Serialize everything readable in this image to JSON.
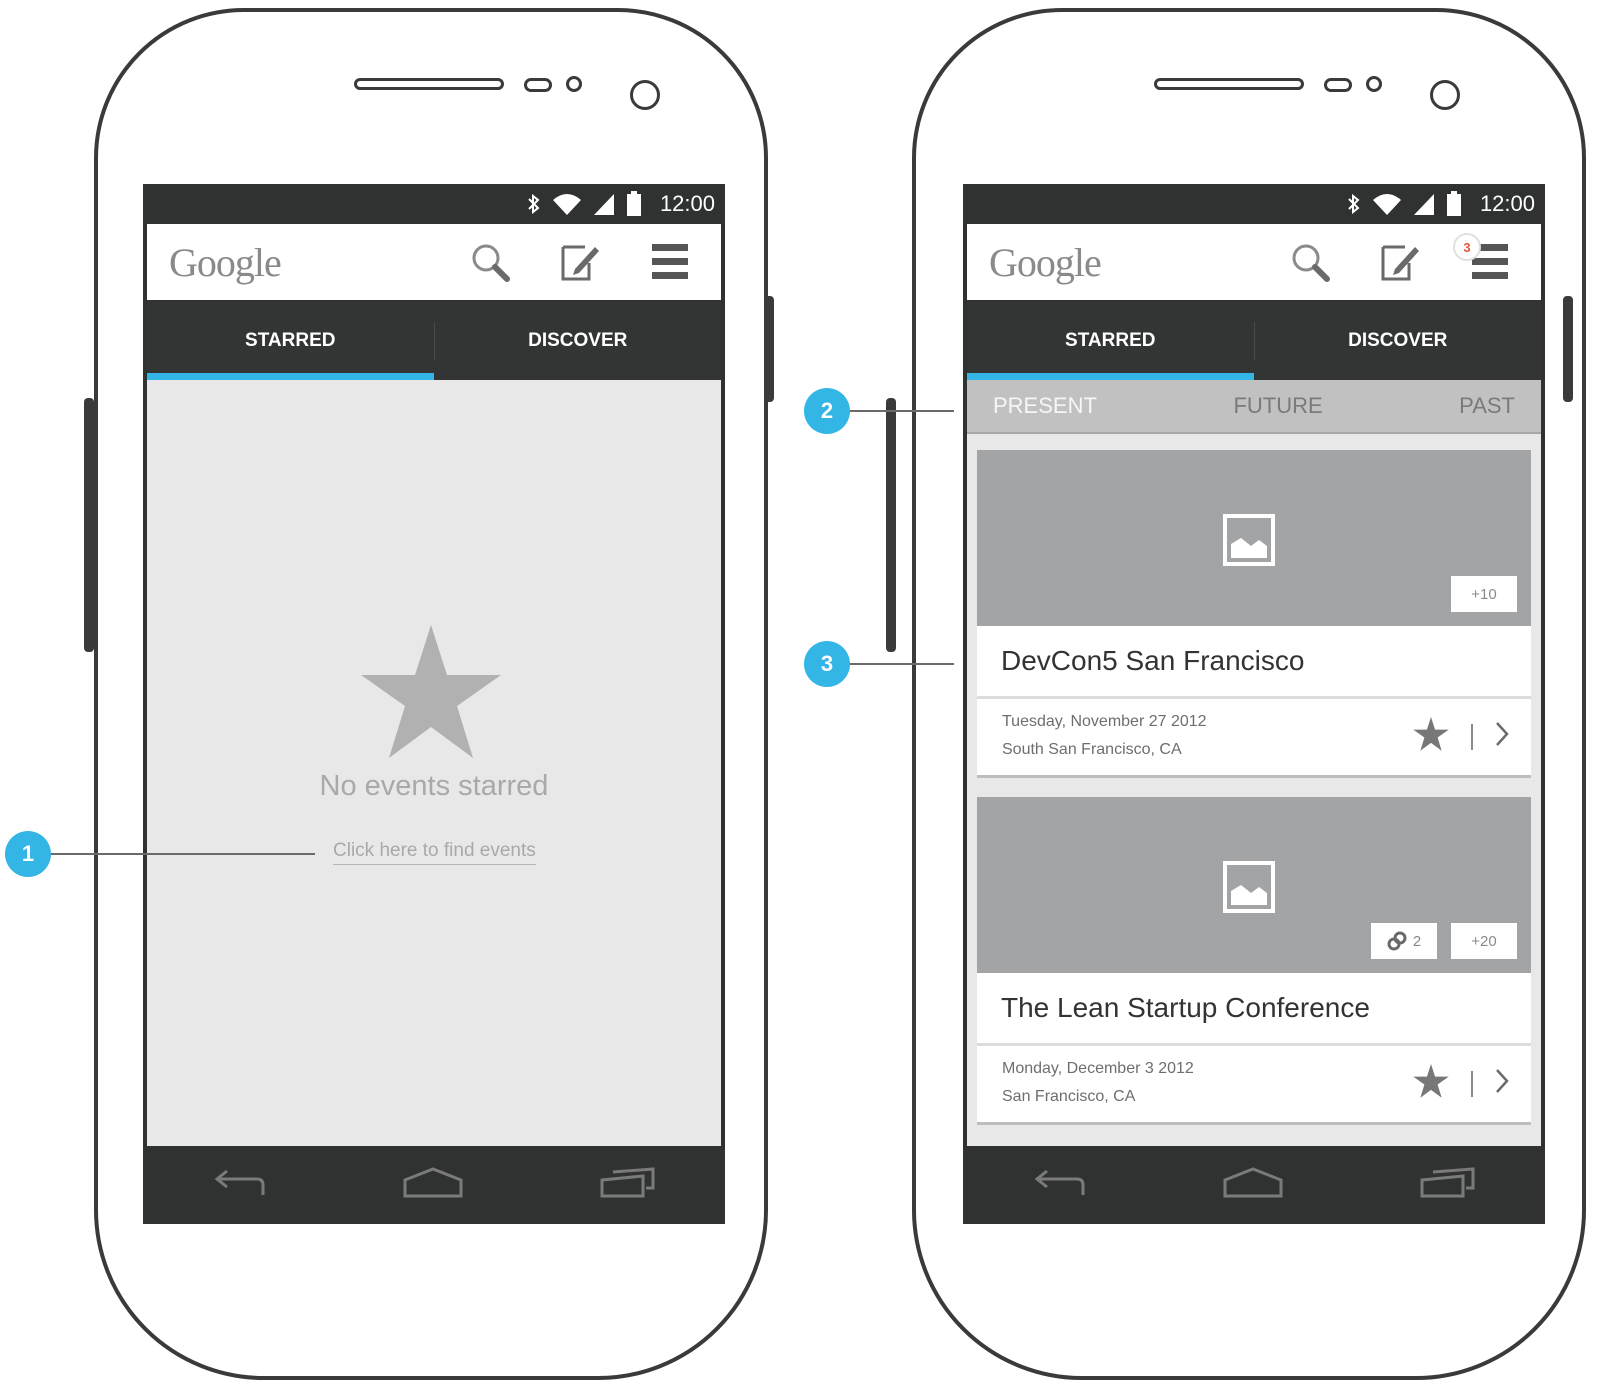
{
  "status": {
    "time": "12:00"
  },
  "app": {
    "logo": "Google",
    "notification_count": "3"
  },
  "tabs": [
    {
      "label": "STARRED"
    },
    {
      "label": "DISCOVER"
    }
  ],
  "empty_state": {
    "title": "No events starred",
    "link": "Click here to find events"
  },
  "subtabs": [
    {
      "label": "PRESENT"
    },
    {
      "label": "FUTURE"
    },
    {
      "label": "PAST"
    }
  ],
  "events": [
    {
      "title": "DevCon5 San Francisco",
      "date": "Tuesday, November 27 2012",
      "location": "South San Francisco, CA",
      "attendees_extra": "+10"
    },
    {
      "title": "The Lean Startup Conference",
      "date": "Monday, December 3 2012",
      "location": "San Francisco, CA",
      "link_count": "2",
      "attendees_extra": "+20"
    }
  ],
  "callouts": [
    "1",
    "2",
    "3"
  ],
  "colors": {
    "accent": "#33b5e5",
    "badge_text": "#e05a3a",
    "frame": "#3a3a3a"
  }
}
